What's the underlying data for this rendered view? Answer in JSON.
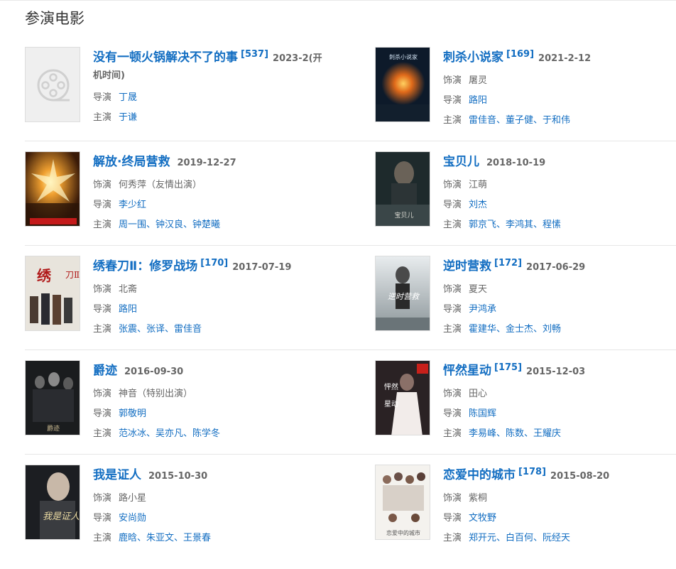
{
  "section_title": "参演电影",
  "labels": {
    "role": "饰演",
    "director": "导演",
    "cast": "主演"
  },
  "films": [
    {
      "title": "没有一顿火锅解决不了的事",
      "count": "[537]",
      "date": "2023-2(开机时间)",
      "role": "",
      "director": "丁晟",
      "cast": "于谦",
      "poster": "placeholder"
    },
    {
      "title": "刺杀小说家",
      "count": "[169]",
      "date": "2021-2-12",
      "role": "屠灵",
      "director": "路阳",
      "cast": "雷佳音、董子健、于和伟",
      "poster": "poster-cisha"
    },
    {
      "title": "解放·终局营救",
      "count": "",
      "date": "2019-12-27",
      "role": "何秀萍（友情出演）",
      "director": "李少红",
      "cast": "周一围、钟汉良、钟楚曦",
      "poster": "poster-jiefang"
    },
    {
      "title": "宝贝儿",
      "count": "",
      "date": "2018-10-19",
      "role": "江萌",
      "director": "刘杰",
      "cast": "郭京飞、李鸿其、程愫",
      "poster": "poster-baobeier"
    },
    {
      "title": "绣春刀Ⅱ：修罗战场",
      "count": "[170]",
      "date": "2017-07-19",
      "role": "北斋",
      "director": "路阳",
      "cast": "张震、张译、雷佳音",
      "poster": "poster-xiuchundao"
    },
    {
      "title": "逆时营救",
      "count": "[172]",
      "date": "2017-06-29",
      "role": "夏天",
      "director": "尹鸿承",
      "cast": "霍建华、金士杰、刘畅",
      "poster": "poster-nishi"
    },
    {
      "title": "爵迹",
      "count": "",
      "date": "2016-09-30",
      "role": "神音（特别出演）",
      "director": "郭敬明",
      "cast": "范冰冰、吴亦凡、陈学冬",
      "poster": "poster-jueji"
    },
    {
      "title": "怦然星动",
      "count": "[175]",
      "date": "2015-12-03",
      "role": "田心",
      "director": "陈国辉",
      "cast": "李易峰、陈数、王耀庆",
      "poster": "poster-pengran"
    },
    {
      "title": "我是证人",
      "count": "",
      "date": "2015-10-30",
      "role": "路小星",
      "director": "安尚勋",
      "cast": "鹿晗、朱亚文、王景春",
      "poster": "poster-zhengren"
    },
    {
      "title": "恋爱中的城市",
      "count": "[178]",
      "date": "2015-08-20",
      "role": "紫桐",
      "director": "文牧野",
      "cast": "郑开元、白百何、阮经天",
      "poster": "poster-lianai"
    }
  ],
  "colors": {
    "link": "#136ec2",
    "label": "#666666"
  }
}
